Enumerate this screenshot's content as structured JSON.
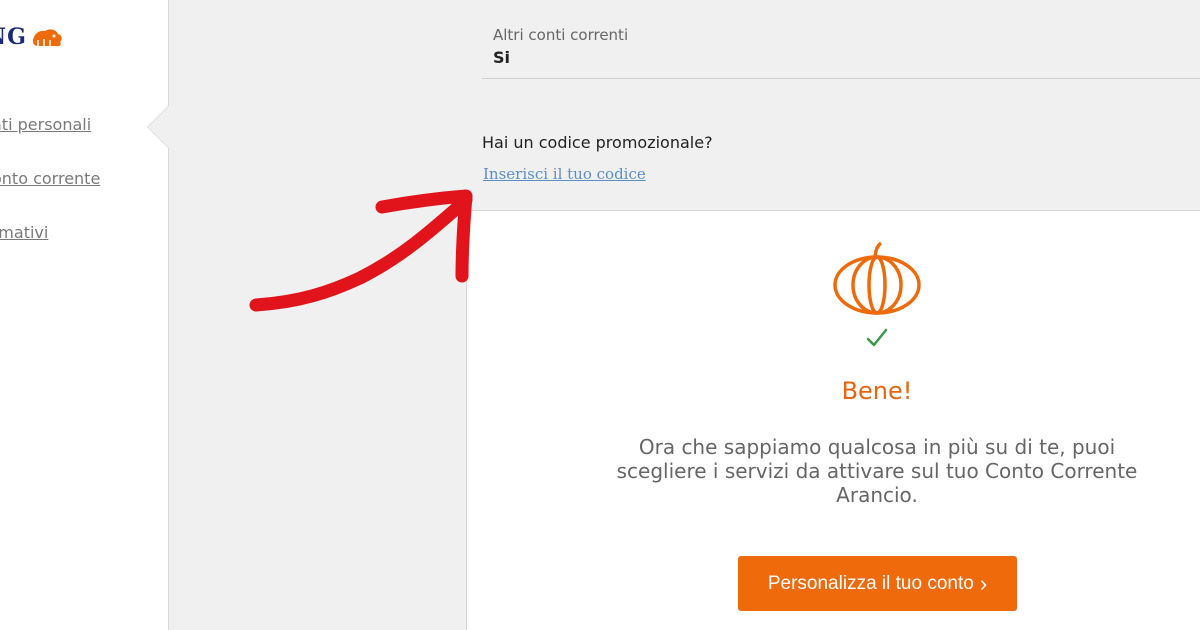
{
  "brand": {
    "logo_text": "NG"
  },
  "sidebar": {
    "items": [
      {
        "label": "ati personali"
      },
      {
        "label": "onto corrente"
      },
      {
        "label": "rmativi"
      }
    ]
  },
  "form": {
    "other_accounts_label": "Altri conti correnti",
    "other_accounts_value": "Si",
    "promo_question": "Hai un codice promozionale?",
    "promo_link": "Inserisci il tuo codice"
  },
  "confirmation": {
    "icon": "pumpkin-icon",
    "check_icon": "checkmark-icon",
    "title": "Bene!",
    "message": "Ora che sappiamo qualcosa in più su di te, puoi scegliere i servizi da attivare sul tuo Conto Corrente Arancio.",
    "cta_label": "Personalizza il tuo conto"
  },
  "colors": {
    "accent_orange": "#ee6a0a",
    "title_orange": "#e8650f",
    "check_green": "#3a9a4a",
    "link_blue": "#5a8fc6",
    "annotation_red": "#e0141a"
  }
}
